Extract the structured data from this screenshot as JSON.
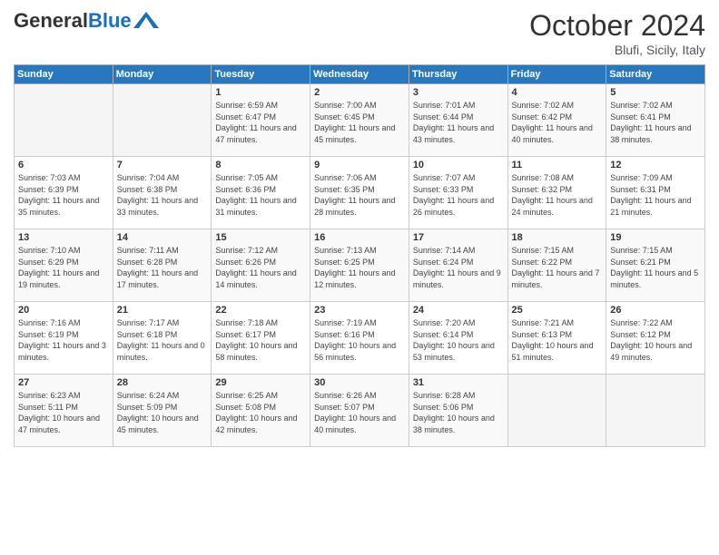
{
  "logo": {
    "general": "General",
    "blue": "Blue"
  },
  "header": {
    "month": "October 2024",
    "location": "Blufi, Sicily, Italy"
  },
  "weekdays": [
    "Sunday",
    "Monday",
    "Tuesday",
    "Wednesday",
    "Thursday",
    "Friday",
    "Saturday"
  ],
  "weeks": [
    [
      {
        "day": "",
        "info": ""
      },
      {
        "day": "",
        "info": ""
      },
      {
        "day": "1",
        "info": "Sunrise: 6:59 AM\nSunset: 6:47 PM\nDaylight: 11 hours and 47 minutes."
      },
      {
        "day": "2",
        "info": "Sunrise: 7:00 AM\nSunset: 6:45 PM\nDaylight: 11 hours and 45 minutes."
      },
      {
        "day": "3",
        "info": "Sunrise: 7:01 AM\nSunset: 6:44 PM\nDaylight: 11 hours and 43 minutes."
      },
      {
        "day": "4",
        "info": "Sunrise: 7:02 AM\nSunset: 6:42 PM\nDaylight: 11 hours and 40 minutes."
      },
      {
        "day": "5",
        "info": "Sunrise: 7:02 AM\nSunset: 6:41 PM\nDaylight: 11 hours and 38 minutes."
      }
    ],
    [
      {
        "day": "6",
        "info": "Sunrise: 7:03 AM\nSunset: 6:39 PM\nDaylight: 11 hours and 35 minutes."
      },
      {
        "day": "7",
        "info": "Sunrise: 7:04 AM\nSunset: 6:38 PM\nDaylight: 11 hours and 33 minutes."
      },
      {
        "day": "8",
        "info": "Sunrise: 7:05 AM\nSunset: 6:36 PM\nDaylight: 11 hours and 31 minutes."
      },
      {
        "day": "9",
        "info": "Sunrise: 7:06 AM\nSunset: 6:35 PM\nDaylight: 11 hours and 28 minutes."
      },
      {
        "day": "10",
        "info": "Sunrise: 7:07 AM\nSunset: 6:33 PM\nDaylight: 11 hours and 26 minutes."
      },
      {
        "day": "11",
        "info": "Sunrise: 7:08 AM\nSunset: 6:32 PM\nDaylight: 11 hours and 24 minutes."
      },
      {
        "day": "12",
        "info": "Sunrise: 7:09 AM\nSunset: 6:31 PM\nDaylight: 11 hours and 21 minutes."
      }
    ],
    [
      {
        "day": "13",
        "info": "Sunrise: 7:10 AM\nSunset: 6:29 PM\nDaylight: 11 hours and 19 minutes."
      },
      {
        "day": "14",
        "info": "Sunrise: 7:11 AM\nSunset: 6:28 PM\nDaylight: 11 hours and 17 minutes."
      },
      {
        "day": "15",
        "info": "Sunrise: 7:12 AM\nSunset: 6:26 PM\nDaylight: 11 hours and 14 minutes."
      },
      {
        "day": "16",
        "info": "Sunrise: 7:13 AM\nSunset: 6:25 PM\nDaylight: 11 hours and 12 minutes."
      },
      {
        "day": "17",
        "info": "Sunrise: 7:14 AM\nSunset: 6:24 PM\nDaylight: 11 hours and 9 minutes."
      },
      {
        "day": "18",
        "info": "Sunrise: 7:15 AM\nSunset: 6:22 PM\nDaylight: 11 hours and 7 minutes."
      },
      {
        "day": "19",
        "info": "Sunrise: 7:15 AM\nSunset: 6:21 PM\nDaylight: 11 hours and 5 minutes."
      }
    ],
    [
      {
        "day": "20",
        "info": "Sunrise: 7:16 AM\nSunset: 6:19 PM\nDaylight: 11 hours and 3 minutes."
      },
      {
        "day": "21",
        "info": "Sunrise: 7:17 AM\nSunset: 6:18 PM\nDaylight: 11 hours and 0 minutes."
      },
      {
        "day": "22",
        "info": "Sunrise: 7:18 AM\nSunset: 6:17 PM\nDaylight: 10 hours and 58 minutes."
      },
      {
        "day": "23",
        "info": "Sunrise: 7:19 AM\nSunset: 6:16 PM\nDaylight: 10 hours and 56 minutes."
      },
      {
        "day": "24",
        "info": "Sunrise: 7:20 AM\nSunset: 6:14 PM\nDaylight: 10 hours and 53 minutes."
      },
      {
        "day": "25",
        "info": "Sunrise: 7:21 AM\nSunset: 6:13 PM\nDaylight: 10 hours and 51 minutes."
      },
      {
        "day": "26",
        "info": "Sunrise: 7:22 AM\nSunset: 6:12 PM\nDaylight: 10 hours and 49 minutes."
      }
    ],
    [
      {
        "day": "27",
        "info": "Sunrise: 6:23 AM\nSunset: 5:11 PM\nDaylight: 10 hours and 47 minutes."
      },
      {
        "day": "28",
        "info": "Sunrise: 6:24 AM\nSunset: 5:09 PM\nDaylight: 10 hours and 45 minutes."
      },
      {
        "day": "29",
        "info": "Sunrise: 6:25 AM\nSunset: 5:08 PM\nDaylight: 10 hours and 42 minutes."
      },
      {
        "day": "30",
        "info": "Sunrise: 6:26 AM\nSunset: 5:07 PM\nDaylight: 10 hours and 40 minutes."
      },
      {
        "day": "31",
        "info": "Sunrise: 6:28 AM\nSunset: 5:06 PM\nDaylight: 10 hours and 38 minutes."
      },
      {
        "day": "",
        "info": ""
      },
      {
        "day": "",
        "info": ""
      }
    ]
  ]
}
